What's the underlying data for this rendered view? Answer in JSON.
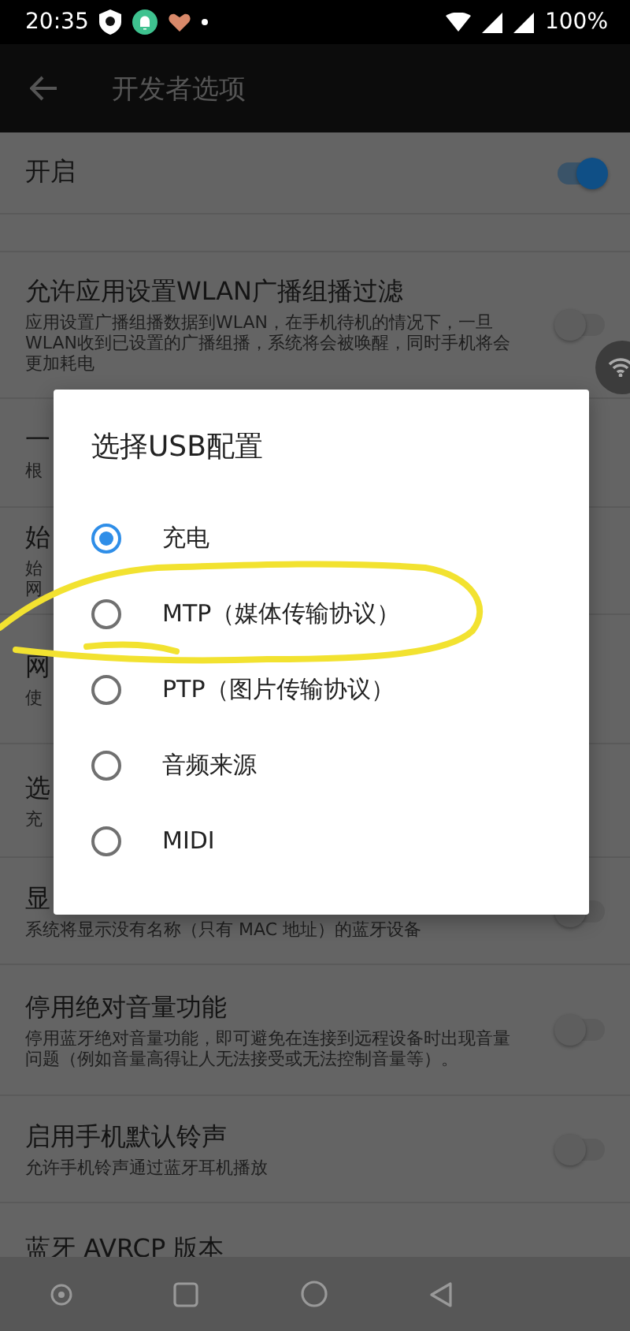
{
  "status_bar": {
    "time": "20:35",
    "battery": "100%"
  },
  "app_bar": {
    "title": "开发者选项"
  },
  "settings": [
    {
      "title": "开启",
      "on": true
    },
    {
      "title": "允许应用设置WLAN广播组播过滤",
      "subtitle": "应用设置广播组播数据到WLAN，在手机待机的情况下，一旦WLAN收到已设置的广播组播，系统将会被唤醒，同时手机将会更加耗电",
      "on": false
    },
    {
      "title": "一",
      "subtitle": "根"
    },
    {
      "title": "始",
      "subtitle": "始网"
    },
    {
      "title": "网",
      "subtitle": "使"
    },
    {
      "title": "选",
      "subtitle": "充"
    },
    {
      "title": "显",
      "subtitle": "系统将显示没有名称（只有 MAC 地址）的蓝牙设备",
      "on": false
    },
    {
      "title": "停用绝对音量功能",
      "subtitle": "停用蓝牙绝对音量功能，即可避免在连接到远程设备时出现音量问题（例如音量高得让人无法接受或无法控制音量等）。",
      "on": false
    },
    {
      "title": "启用手机默认铃声",
      "subtitle": "允许手机铃声通过蓝牙耳机播放",
      "on": false
    },
    {
      "title": "蓝牙 AVRCP 版本"
    }
  ],
  "dialog": {
    "title": "选择USB配置",
    "options": [
      {
        "label": "充电",
        "selected": true
      },
      {
        "label": "MTP（媒体传输协议）",
        "selected": false
      },
      {
        "label": "PTP（图片传输协议）",
        "selected": false
      },
      {
        "label": "音频来源",
        "selected": false
      },
      {
        "label": "MIDI",
        "selected": false
      }
    ]
  }
}
